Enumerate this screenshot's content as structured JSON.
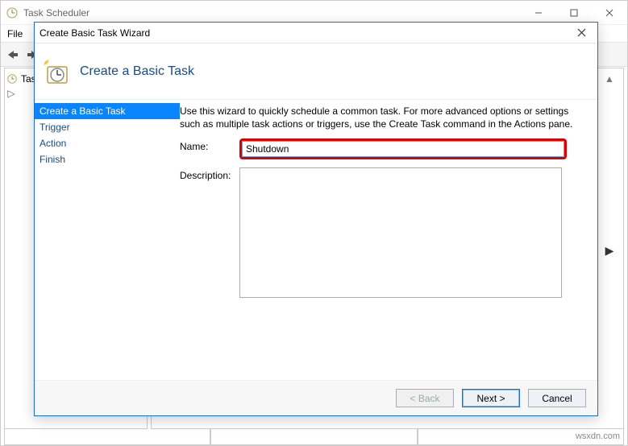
{
  "parent": {
    "title": "Task Scheduler",
    "menu": {
      "file": "File"
    },
    "tree": {
      "root": "Tas"
    }
  },
  "wizard": {
    "window_title": "Create Basic Task Wizard",
    "header": "Create a Basic Task",
    "nav": {
      "step1": "Create a Basic Task",
      "step2": "Trigger",
      "step3": "Action",
      "step4": "Finish"
    },
    "intro": "Use this wizard to quickly schedule a common task.  For more advanced options or settings such as multiple task actions or triggers, use the Create Task command in the Actions pane.",
    "labels": {
      "name": "Name:",
      "description": "Description:"
    },
    "fields": {
      "name": "Shutdown",
      "description": ""
    },
    "buttons": {
      "back": "< Back",
      "next": "Next >",
      "cancel": "Cancel"
    }
  },
  "watermark": "wsxdn.com"
}
